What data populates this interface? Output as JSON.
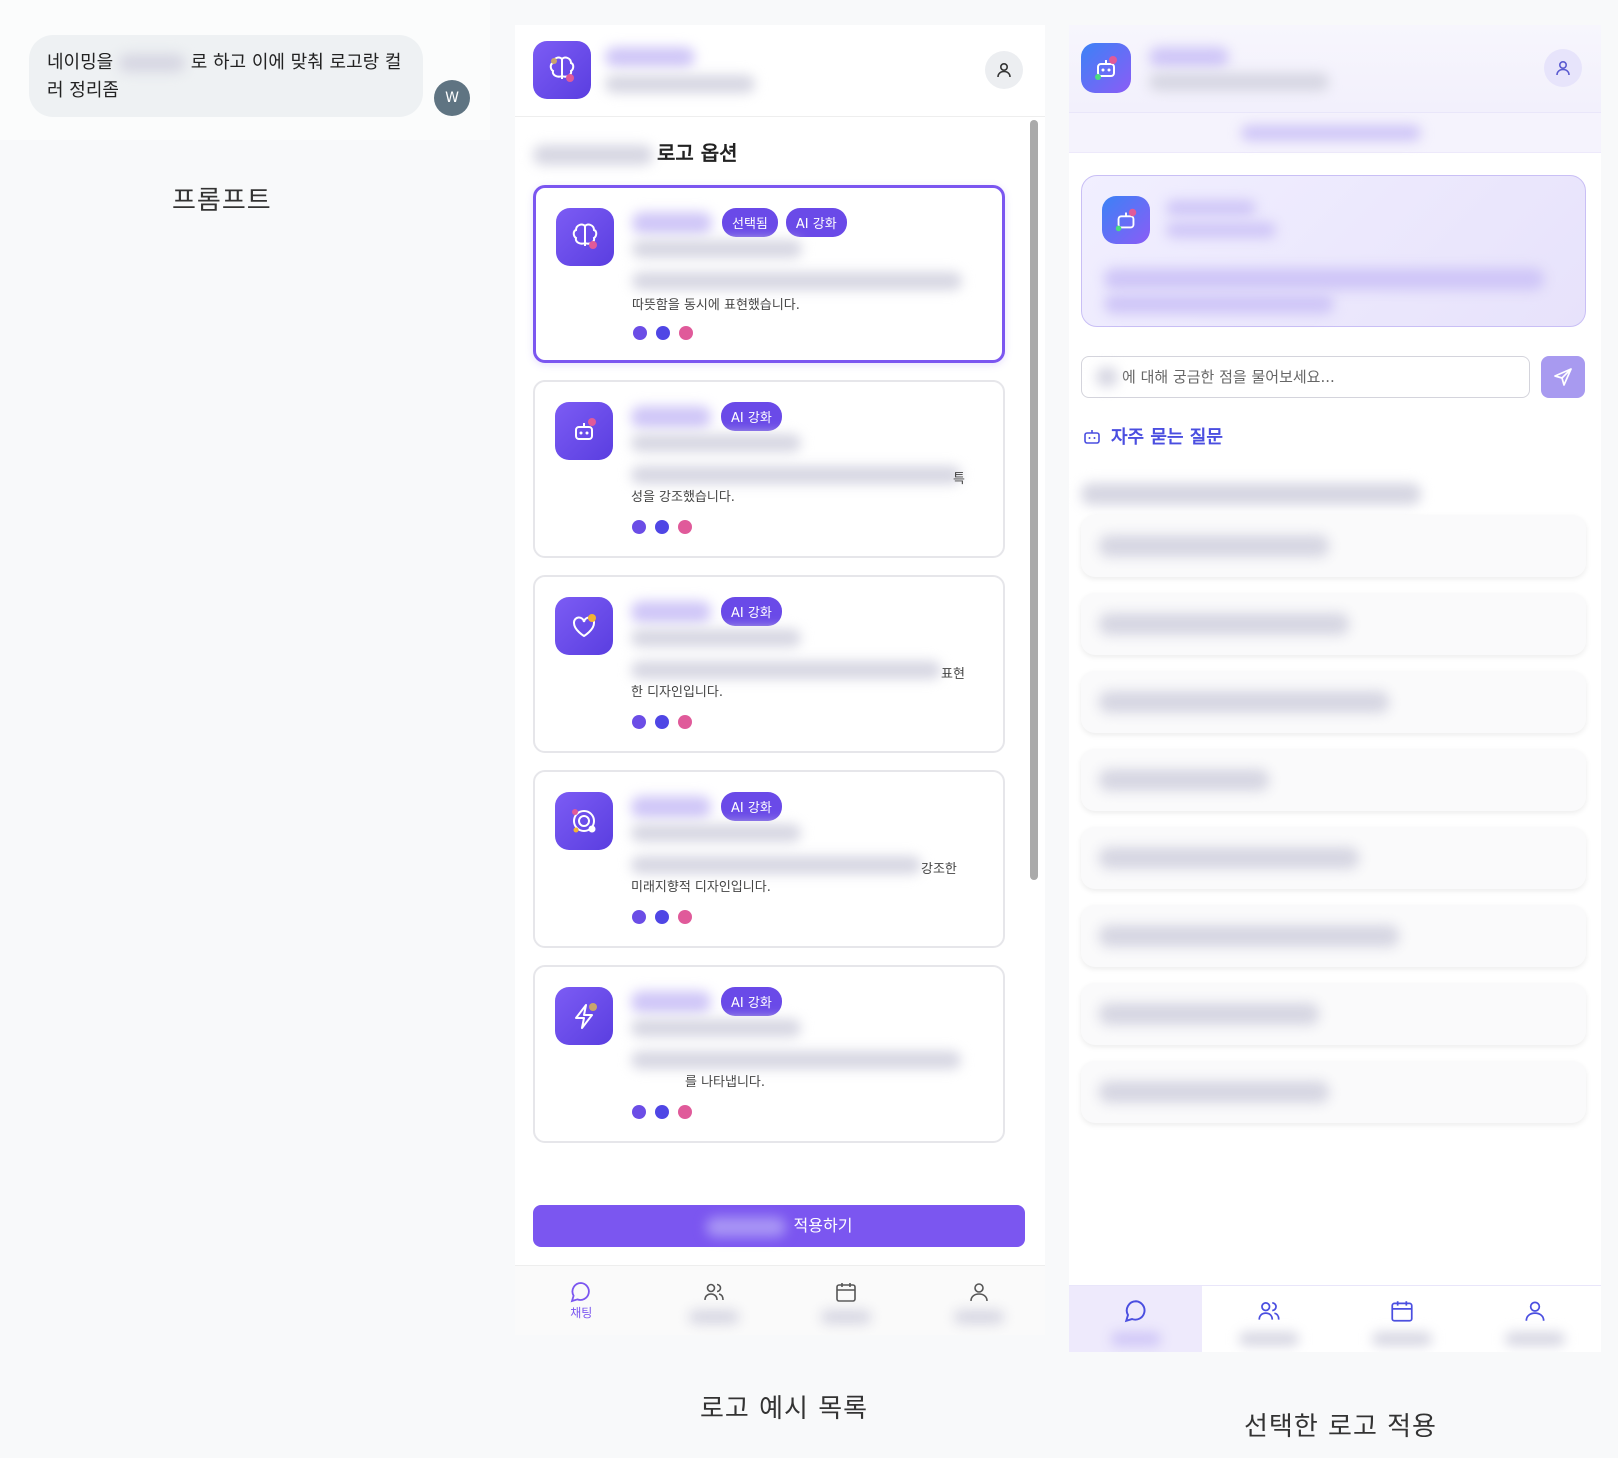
{
  "prompt_panel": {
    "message_before": "네이밍을",
    "message_after": "로 하고 이에 맞춰 로고랑 컬러 정리좀",
    "avatar_initial": "W",
    "caption": "프롬프트"
  },
  "list_panel": {
    "section_title": "로고 옵션",
    "badge_selected": "선택됨",
    "badge_ai": "AI 강화",
    "cards": [
      {
        "text": "따뜻함을 동시에 표현했습니다.",
        "icon": "brain-icon",
        "selected": true
      },
      {
        "text_right": "특",
        "text": "성을 강조했습니다.",
        "icon": "robot-icon",
        "selected": false
      },
      {
        "text_right": "표현",
        "text": "한 디자인입니다.",
        "icon": "heart-icon",
        "selected": false
      },
      {
        "text_right": "강조한",
        "text": "미래지향적 디자인입니다.",
        "icon": "orbit-icon",
        "selected": false
      },
      {
        "text": "를 나타냅니다.",
        "icon": "lightning-icon",
        "selected": false
      }
    ],
    "palette": [
      "#6b4de6",
      "#4f46e5",
      "#e05a9a"
    ],
    "apply_label": "적용하기",
    "tabs": [
      {
        "label": "채팅",
        "icon": "chat-icon"
      },
      {
        "label": "",
        "icon": "users-icon"
      },
      {
        "label": "",
        "icon": "calendar-icon"
      },
      {
        "label": "",
        "icon": "profile-icon"
      }
    ],
    "caption": "로고 예시 목록"
  },
  "applied_panel": {
    "input_placeholder": "에 대해 궁금한 점을 물어보세요...",
    "faq_title": "자주 묻는 질문",
    "faq_count": 8,
    "caption": "선택한 로고 적용"
  },
  "colors": {
    "accent": "#7b56f0",
    "accent_dark": "#5a3ee0",
    "faq_blue": "#4a4ee0"
  }
}
